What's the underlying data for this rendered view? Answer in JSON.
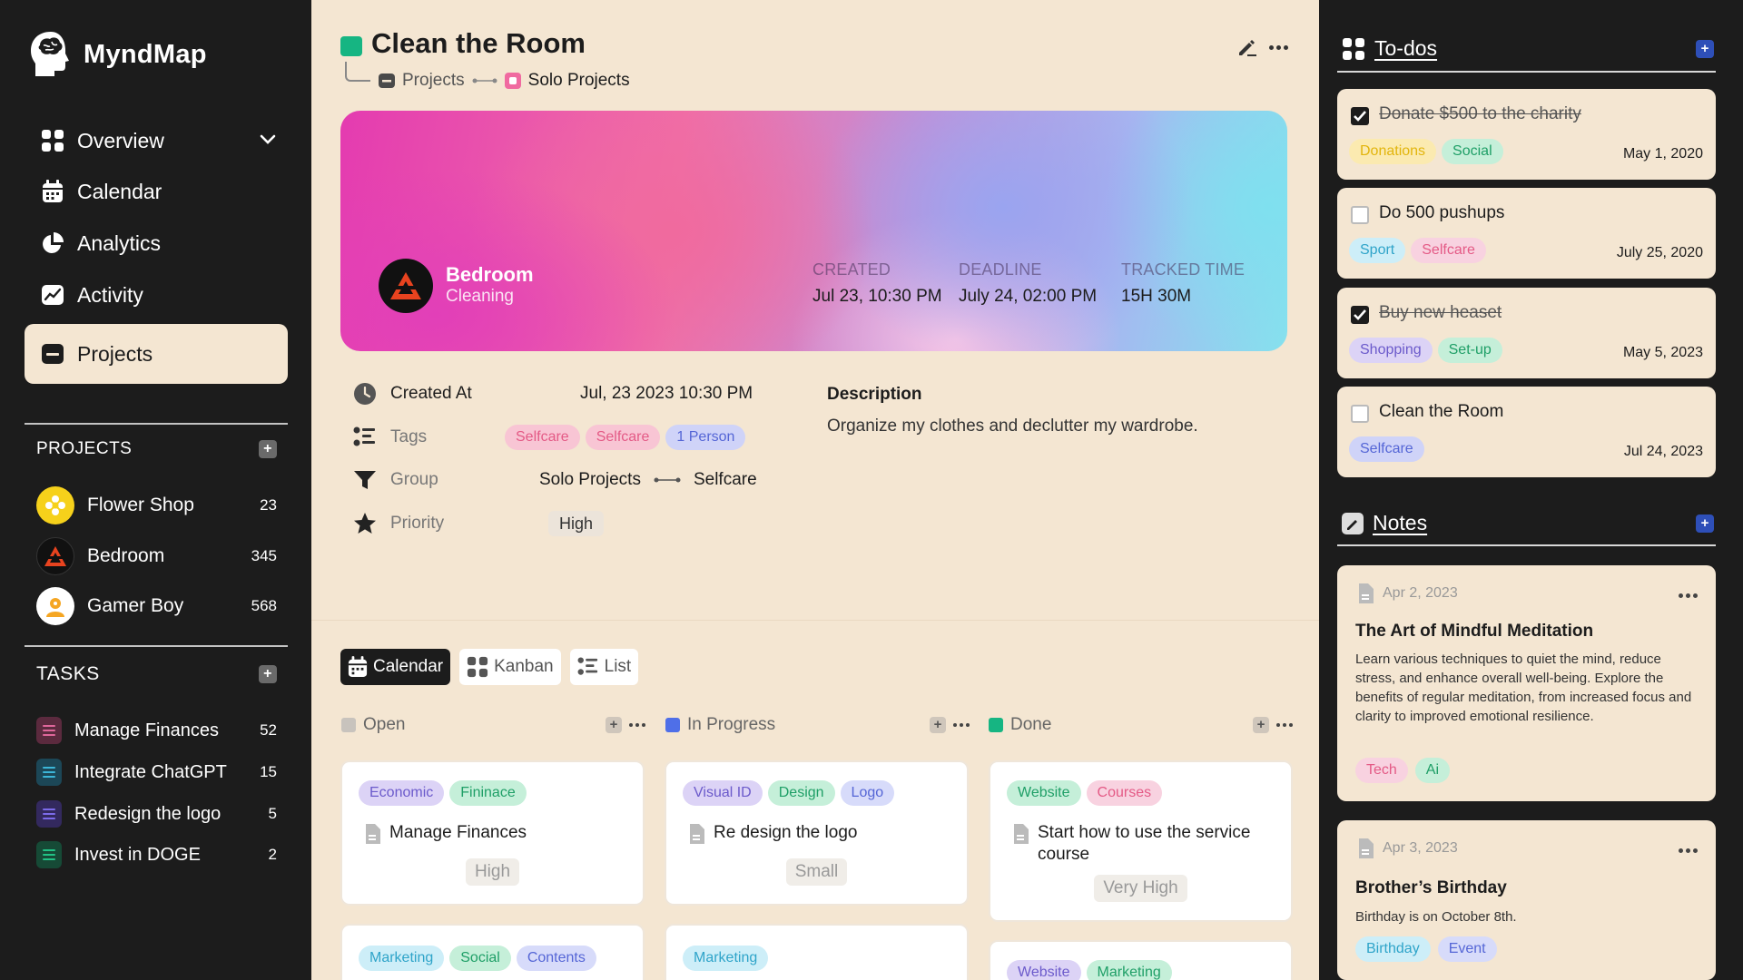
{
  "app": {
    "name": "MyndMap"
  },
  "nav": [
    {
      "label": "Overview",
      "icon": "grid-icon"
    },
    {
      "label": "Calendar",
      "icon": "calendar-icon"
    },
    {
      "label": "Analytics",
      "icon": "pie-chart-icon"
    },
    {
      "label": "Activity",
      "icon": "activity-chart-icon"
    },
    {
      "label": "Projects",
      "icon": "folder-icon",
      "active": true
    }
  ],
  "projects_section": {
    "title": "PROJECTS",
    "items": [
      {
        "name": "Flower Shop",
        "count": "23",
        "color": "#f6d11b"
      },
      {
        "name": "Bedroom",
        "count": "345",
        "color": "#111111"
      },
      {
        "name": "Gamer Boy",
        "count": "568",
        "color": "#f5a623"
      }
    ]
  },
  "tasks_section": {
    "title": "TASKS",
    "items": [
      {
        "name": "Manage Finances",
        "count": "52",
        "color": "#d4588c"
      },
      {
        "name": "Integrate ChatGPT",
        "count": "15",
        "color": "#2fa4c9"
      },
      {
        "name": "Redesign the logo",
        "count": "5",
        "color": "#6a5cd9"
      },
      {
        "name": "Invest in DOGE",
        "count": "2",
        "color": "#1fae7a"
      }
    ]
  },
  "page": {
    "title": "Clean the Room",
    "accent": "#16b582",
    "breadcrumb": {
      "parent": "Projects",
      "child": "Solo Projects"
    }
  },
  "banner": {
    "name": "Bedroom",
    "subtitle": "Cleaning",
    "stats": [
      {
        "label": "CREATED",
        "value": "Jul 23, 10:30 PM"
      },
      {
        "label": "DEADLINE",
        "value": "July 24, 02:00 PM"
      },
      {
        "label": "TRACKED TIME",
        "value": "15H 30M"
      }
    ]
  },
  "props": {
    "created_label": "Created At",
    "created_value": "Jul, 23 2023 10:30 PM",
    "tags_label": "Tags",
    "tags": [
      "Selfcare",
      "Selfcare",
      "1 Person"
    ],
    "group_label": "Group",
    "group_from": "Solo Projects",
    "group_to": "Selfcare",
    "priority_label": "Priority",
    "priority_value": "High"
  },
  "description": {
    "title": "Description",
    "text": "Organize my clothes and declutter my wardrobe."
  },
  "views": [
    "Calendar",
    "Kanban",
    "List"
  ],
  "columns": [
    {
      "name": "Open",
      "color": "#c8c3bd"
    },
    {
      "name": "In Progress",
      "color": "#4f6fe8"
    },
    {
      "name": "Done",
      "color": "#16b582"
    }
  ],
  "kanban": {
    "open": [
      {
        "tags": [
          "Economic",
          "Fininace"
        ],
        "title": "Manage Finances",
        "priority": "High"
      },
      {
        "tags": [
          "Marketing",
          "Social",
          "Contents"
        ]
      }
    ],
    "progress": [
      {
        "tags": [
          "Visual ID",
          "Design",
          "Logo"
        ],
        "title": "Re design the logo",
        "priority": "Small"
      },
      {
        "tags": [
          "Marketing"
        ]
      }
    ],
    "done": [
      {
        "tags": [
          "Website",
          "Courses"
        ],
        "title": "Start how to use the service course",
        "priority": "Very High"
      },
      {
        "tags": [
          "Website",
          "Marketing"
        ]
      }
    ]
  },
  "todos": {
    "title": "To-dos",
    "items": [
      {
        "text": "Donate $500 to the charity",
        "done": true,
        "tags": [
          "Donations",
          "Social"
        ],
        "date": "May 1, 2020"
      },
      {
        "text": "Do 500 pushups",
        "done": false,
        "tags": [
          "Sport",
          "Selfcare"
        ],
        "date": "July 25, 2020"
      },
      {
        "text": "Buy new heaset",
        "done": true,
        "tags": [
          "Shopping",
          "Set-up"
        ],
        "date": "May 5, 2023"
      },
      {
        "text": "Clean the Room",
        "done": false,
        "tags": [
          "Selfcare"
        ],
        "date": "Jul 24, 2023"
      }
    ]
  },
  "notes": {
    "title": "Notes",
    "items": [
      {
        "date": "Apr 2, 2023",
        "title": "The Art of Mindful Meditation",
        "body": "Learn various techniques to quiet the mind, reduce stress, and enhance overall well-being. Explore the benefits of regular meditation, from increased focus and clarity to improved emotional resilience.",
        "tags": [
          "Tech",
          "Ai"
        ]
      },
      {
        "date": "Apr 3, 2023",
        "title": "Brother’s Birthday",
        "body": "Birthday is on October 8th.",
        "tags": [
          "Birthday",
          "Event"
        ]
      }
    ]
  }
}
